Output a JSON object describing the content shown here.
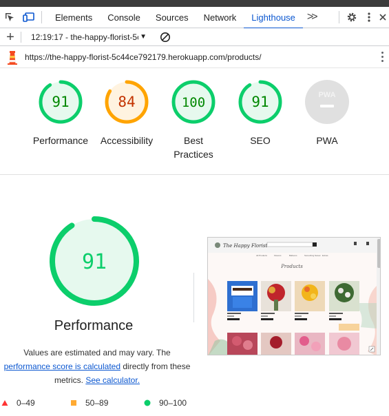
{
  "devtools": {
    "tabs": [
      "Elements",
      "Console",
      "Sources",
      "Network",
      "Lighthouse"
    ],
    "active_tab": "Lighthouse"
  },
  "lighthouse_bar": {
    "report_label": "12:19:17 - the-happy-florist-5c"
  },
  "url": "https://the-happy-florist-5c44ce792179.herokuapp.com/products/",
  "scores": [
    {
      "label": "Performance",
      "value": "91",
      "fraction": 0.91,
      "status": "pass"
    },
    {
      "label": "Accessibility",
      "value": "84",
      "fraction": 0.84,
      "status": "average"
    },
    {
      "label": "Best",
      "label2": "Practices",
      "value": "100",
      "fraction": 1.0,
      "status": "pass"
    },
    {
      "label": "SEO",
      "value": "91",
      "fraction": 0.91,
      "status": "pass"
    },
    {
      "label": "PWA",
      "value": "",
      "fraction": 0,
      "status": "na"
    }
  ],
  "pwa_badge": "PWA",
  "main": {
    "score": "91",
    "title": "Performance",
    "note_1": "Values are estimated and may vary. The",
    "link_1": "performance score is calculated",
    "note_2": "directly from these",
    "note_3": "metrics.",
    "link_2": "See calculator."
  },
  "thumbnail": {
    "brand": "The Happy Florist",
    "nav": [
      "All Products",
      "Flowers",
      "Balloons",
      "Something Sweet",
      "Extras"
    ],
    "heading": "Products"
  },
  "legend": [
    {
      "range": "0–49",
      "shape": "triangle",
      "color": "#ff3333"
    },
    {
      "range": "50–89",
      "shape": "square",
      "color": "#ffaa33"
    },
    {
      "range": "90–100",
      "shape": "circle",
      "color": "#0cce6b"
    }
  ],
  "colors": {
    "pass": "#0cce6b",
    "pass_text": "#008800",
    "pass_bg": "#e6f9ee",
    "average": "#ffa400",
    "average_text": "#c33300",
    "average_bg": "#fff3e0",
    "na": "#cccccc",
    "link": "#0b57d0",
    "active_tab": "#0b57d0"
  }
}
